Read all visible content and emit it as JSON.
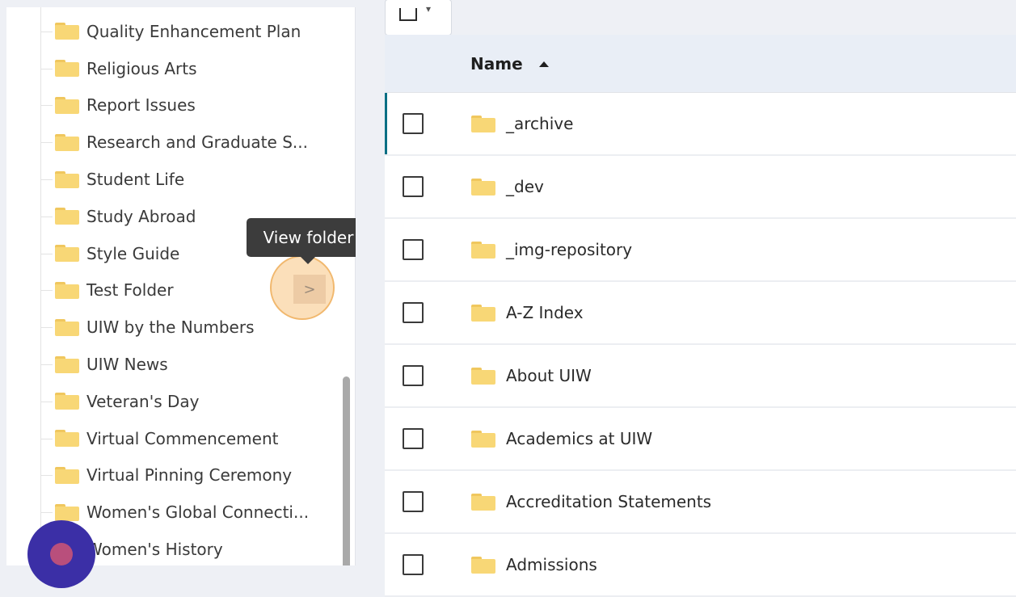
{
  "sidebar": {
    "items": [
      {
        "label": "Quality Enhancement Plan"
      },
      {
        "label": "Religious Arts"
      },
      {
        "label": "Report Issues"
      },
      {
        "label": "Research and Graduate S..."
      },
      {
        "label": "Student Life"
      },
      {
        "label": "Study Abroad"
      },
      {
        "label": "Style Guide"
      },
      {
        "label": "Test Folder"
      },
      {
        "label": "UIW by the Numbers"
      },
      {
        "label": "UIW News"
      },
      {
        "label": "Veteran's Day"
      },
      {
        "label": "Virtual Commencement"
      },
      {
        "label": "Virtual Pinning Ceremony"
      },
      {
        "label": "Women's Global Connecti..."
      },
      {
        "label": "Women's History"
      }
    ]
  },
  "tooltip": {
    "text": "View folder"
  },
  "view_folder_button": {
    "glyph": ">"
  },
  "table": {
    "header": {
      "name_label": "Name"
    },
    "rows": [
      {
        "name": "_archive"
      },
      {
        "name": "_dev"
      },
      {
        "name": "_img-repository"
      },
      {
        "name": "A-Z Index"
      },
      {
        "name": "About UIW"
      },
      {
        "name": "Academics at UIW"
      },
      {
        "name": "Accreditation Statements"
      },
      {
        "name": "Admissions"
      }
    ]
  },
  "colors": {
    "folder": "#f8d776",
    "selected_accent": "#0a6f84",
    "tooltip_bg": "#3c3c3c",
    "highlight": "#f1b86e",
    "cursor_outer": "#3b2fa6",
    "cursor_inner": "#b94f7c"
  }
}
